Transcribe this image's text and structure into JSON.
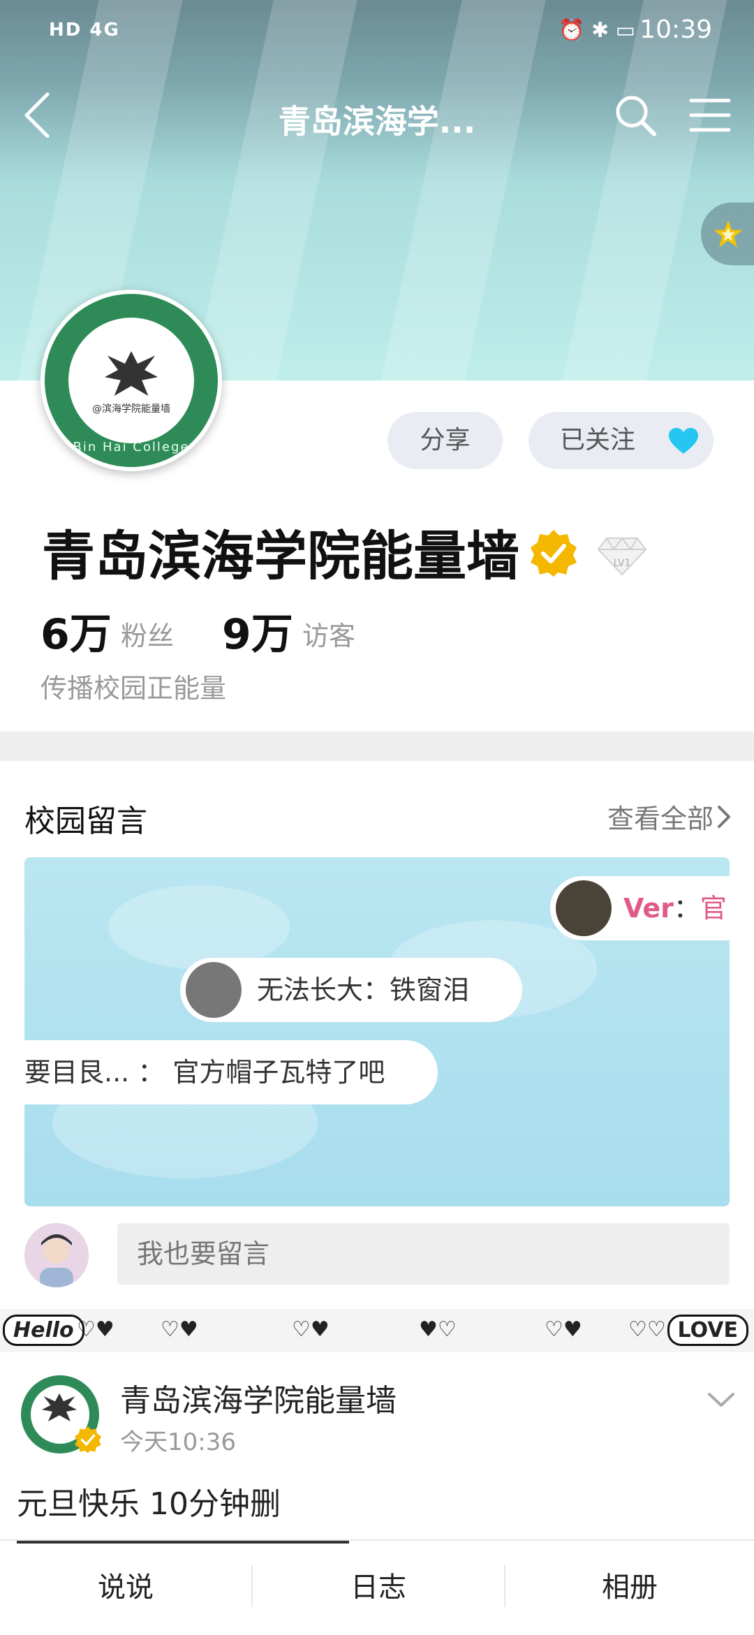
{
  "status_bar": {
    "network": "HD 4G",
    "time": "10:39"
  },
  "header": {
    "title": "青岛滨海学..."
  },
  "profile": {
    "name": "青岛滨海学院能量墙",
    "avatar_ring_text": "Bin Hai College",
    "avatar_tag_text": "@滨海学院能量墙",
    "level_badge": "LV1",
    "share_label": "分享",
    "follow_label": "已关注",
    "followers_count": "6万",
    "followers_label": "粉丝",
    "visitors_count": "9万",
    "visitors_label": "访客",
    "bio": "传播校园正能量"
  },
  "messages": {
    "title": "校园留言",
    "see_all": "查看全部",
    "bubbles": [
      {
        "author": "Ver",
        "sep": "：",
        "text": "官"
      },
      {
        "author": "无法长大",
        "sep": "：",
        "text": "铁窗泪"
      },
      {
        "author": "要目艮...",
        "sep": " ： ",
        "text": "官方帽子瓦特了吧"
      }
    ],
    "input_placeholder": "我也要留言"
  },
  "doodle": {
    "left": "Hello",
    "right": "LOVE"
  },
  "post": {
    "author": "青岛滨海学院能量墙",
    "time": "今天10:36",
    "text": "元旦快乐   10分钟删"
  },
  "tabs": [
    "说说",
    "日志",
    "相册"
  ],
  "colors": {
    "accent_pink": "#e05a8a",
    "heart_blue": "#25c6ef",
    "verify_gold": "#f5b800",
    "avatar_green": "#2e8b57"
  }
}
